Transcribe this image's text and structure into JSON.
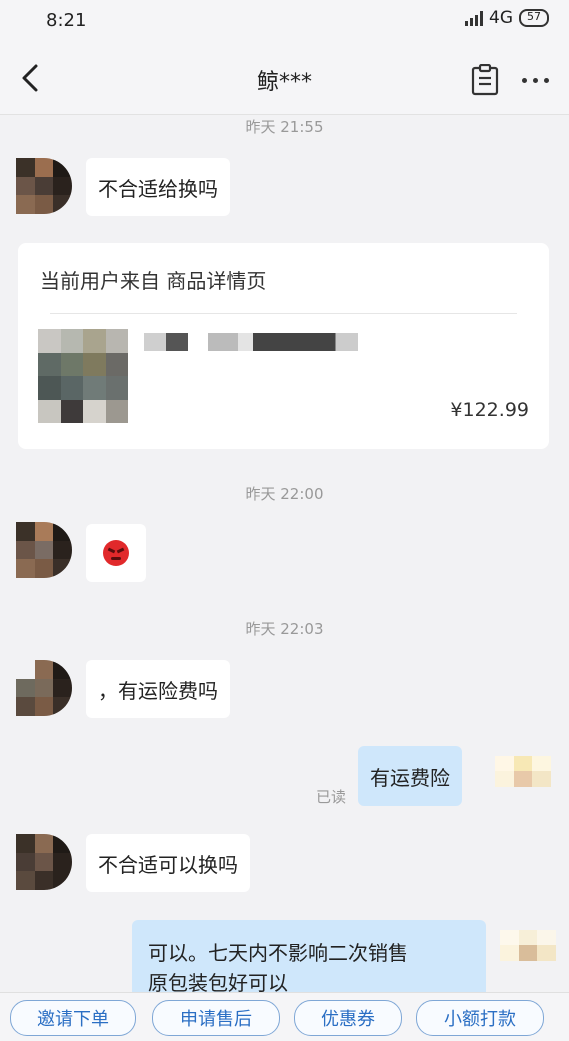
{
  "status_bar": {
    "time": "8:21",
    "network": "4G",
    "battery": "57"
  },
  "header": {
    "title": "鲸***"
  },
  "messages": {
    "t1": "昨天 21:55",
    "m1": "不合适给换吗",
    "card_header": "当前用户来自 商品详情页",
    "card_price": "¥122.99",
    "t2": "昨天 22:00",
    "t3": "昨天 22:03",
    "m3": "，有运险费吗",
    "m4": "有运费险",
    "read": "已读",
    "m5": "不合适可以换吗",
    "m6_line1": "可以。七天内不影响二次销售",
    "m6_line2": "原包装包好可以"
  },
  "bottom_bar": {
    "b1": "邀请下单",
    "b2": "申请售后",
    "b3": "优惠券",
    "b4": "小额打款"
  },
  "colors": {
    "accent": "#2b6fc4",
    "my_bubble": "#cfe7fb",
    "background": "#f2f2f4"
  },
  "icons": [
    "back-arrow-icon",
    "clipboard-icon",
    "more-dots-icon",
    "angry-face-emoji"
  ]
}
